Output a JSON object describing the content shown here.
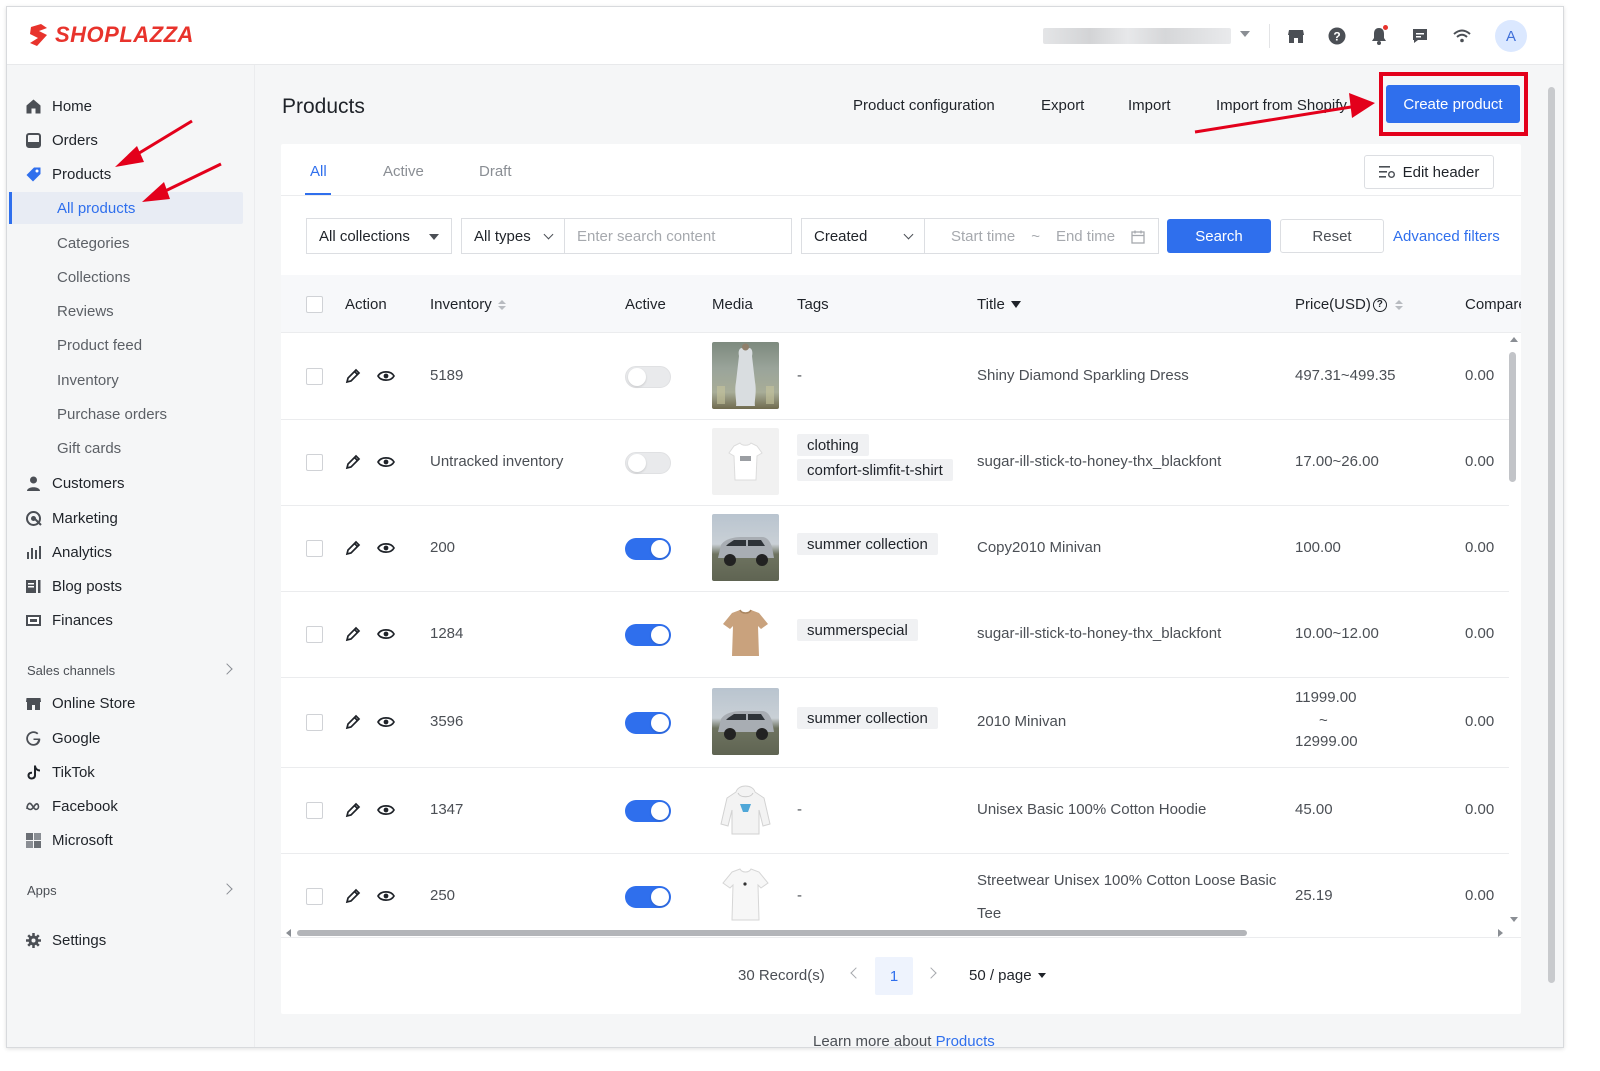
{
  "brand": {
    "name": "SHOPLAZZA",
    "color": "#e8332c"
  },
  "colors": {
    "accent": "#2f6fed",
    "annotation": "#e3001b"
  },
  "topbar": {
    "icons": [
      "store-icon",
      "help-icon",
      "bell-icon",
      "chat-icon",
      "wifi-icon"
    ],
    "avatar_initial": "A"
  },
  "sidebar": {
    "items": [
      {
        "label": "Home",
        "icon": "home-icon"
      },
      {
        "label": "Orders",
        "icon": "orders-icon"
      },
      {
        "label": "Products",
        "icon": "tag-icon"
      },
      {
        "label": "Customers",
        "icon": "person-icon"
      },
      {
        "label": "Marketing",
        "icon": "marketing-icon"
      },
      {
        "label": "Analytics",
        "icon": "bar-chart-icon"
      },
      {
        "label": "Blog posts",
        "icon": "blog-icon"
      },
      {
        "label": "Finances",
        "icon": "finance-icon"
      }
    ],
    "product_sub": [
      {
        "label": "All products",
        "active": true
      },
      {
        "label": "Categories"
      },
      {
        "label": "Collections"
      },
      {
        "label": "Reviews"
      },
      {
        "label": "Product feed"
      },
      {
        "label": "Inventory"
      },
      {
        "label": "Purchase orders"
      },
      {
        "label": "Gift cards"
      }
    ],
    "sales_channels_label": "Sales channels",
    "channels": [
      {
        "label": "Online Store",
        "icon": "store-icon"
      },
      {
        "label": "Google",
        "icon": "google-icon"
      },
      {
        "label": "TikTok",
        "icon": "tiktok-icon"
      },
      {
        "label": "Facebook",
        "icon": "meta-icon"
      },
      {
        "label": "Microsoft",
        "icon": "microsoft-icon"
      }
    ],
    "apps_label": "Apps",
    "settings_label": "Settings"
  },
  "page": {
    "title": "Products",
    "actions": [
      "Product configuration",
      "Export",
      "Import",
      "Import from Shopify"
    ],
    "create_label": "Create product"
  },
  "tabs": [
    "All",
    "Active",
    "Draft"
  ],
  "active_tab": "All",
  "edit_header_label": "Edit header",
  "filters": {
    "collections": "All collections",
    "types": "All types",
    "search_placeholder": "Enter search content",
    "date_field": "Created",
    "start_placeholder": "Start time",
    "range_sep": "~",
    "end_placeholder": "End time",
    "search_label": "Search",
    "reset_label": "Reset",
    "advanced_label": "Advanced filters"
  },
  "columns": [
    "Action",
    "Inventory",
    "Active",
    "Media",
    "Tags",
    "Title",
    "Price(USD)",
    "Compare"
  ],
  "rows": [
    {
      "inventory": "5189",
      "active": false,
      "media": "dress",
      "tags": [
        "-"
      ],
      "title": "Shiny Diamond Sparkling Dress",
      "price": "497.31~499.35",
      "compare": "0.00"
    },
    {
      "inventory": "Untracked inventory",
      "active": false,
      "media": "tshirt-print",
      "tags": [
        "clothing",
        "comfort-slimfit-t-shirt"
      ],
      "title": "sugar-ill-stick-to-honey-thx_blackfont",
      "price": "17.00~26.00",
      "compare": "0.00"
    },
    {
      "inventory": "200",
      "active": true,
      "media": "minivan",
      "tags": [
        "summer collection"
      ],
      "title": "Copy2010 Minivan",
      "price": "100.00",
      "compare": "0.00"
    },
    {
      "inventory": "1284",
      "active": true,
      "media": "tshirt-tan",
      "tags": [
        "summerspecial"
      ],
      "title": "sugar-ill-stick-to-honey-thx_blackfont",
      "price": "10.00~12.00",
      "compare": "0.00"
    },
    {
      "inventory": "3596",
      "active": true,
      "media": "minivan",
      "tags": [
        "summer collection"
      ],
      "title": "2010 Minivan",
      "price_lines": [
        "11999.00",
        "~",
        "12999.00"
      ],
      "compare": "0.00"
    },
    {
      "inventory": "1347",
      "active": true,
      "media": "hoodie",
      "tags": [
        "-"
      ],
      "title": "Unisex Basic 100% Cotton Hoodie",
      "price": "45.00",
      "compare": "0.00"
    },
    {
      "inventory": "250",
      "active": true,
      "media": "tee-white",
      "tags": [
        "-"
      ],
      "title_lines": [
        "Streetwear Unisex 100% Cotton Loose Basic",
        "Tee"
      ],
      "price": "25.19",
      "compare": "0.00"
    }
  ],
  "pagination": {
    "records": "30 Record(s)",
    "current_page": "1",
    "page_size": "50 / page"
  },
  "footer": {
    "learn_prefix": "Learn more about ",
    "learn_link": "Products"
  }
}
